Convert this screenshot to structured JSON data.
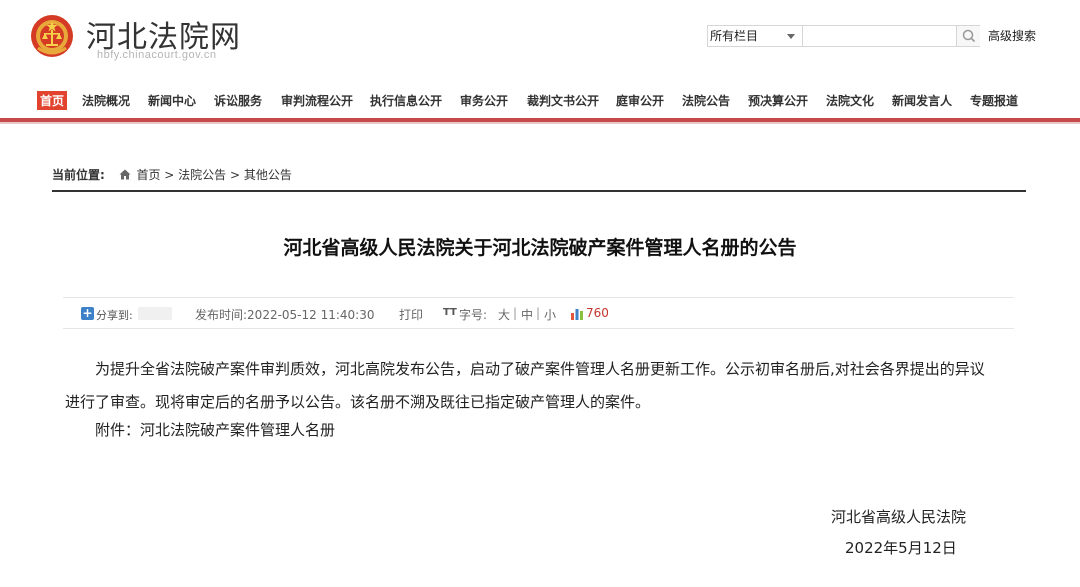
{
  "header": {
    "site_name": "河北法院网",
    "site_domain": "hbfy.chinacourt.gov.cn",
    "search_select": "所有栏目",
    "search_placeholder": "",
    "advanced_search": "高级搜索"
  },
  "nav": {
    "items": [
      {
        "label": "首页",
        "active": true
      },
      {
        "label": "法院概况"
      },
      {
        "label": "新闻中心"
      },
      {
        "label": "诉讼服务"
      },
      {
        "label": "审判流程公开"
      },
      {
        "label": "执行信息公开"
      },
      {
        "label": "审务公开"
      },
      {
        "label": "裁判文书公开"
      },
      {
        "label": "庭审公开"
      },
      {
        "label": "法院公告"
      },
      {
        "label": "预决算公开"
      },
      {
        "label": "法院文化"
      },
      {
        "label": "新闻发言人"
      },
      {
        "label": "专题报道"
      }
    ]
  },
  "breadcrumb": {
    "label": "当前位置:",
    "home": "首页",
    "sep1": " > ",
    "level1": "法院公告",
    "sep2": " > ",
    "level2": "其他公告"
  },
  "article": {
    "title": "河北省高级人民法院关于河北法院破产案件管理人名册的公告",
    "share_label": "分享到:",
    "publish_time": "发布时间:2022-05-12 11:40:30",
    "print": "打印",
    "font_label": "字号:",
    "font_large": "大",
    "font_medium": "中",
    "font_small": "小",
    "font_sep": "|",
    "views": "760",
    "paragraph1_line1": "为提升全省法院破产案件审判质效，河北高院发布公告，启动了破产案件管理人名册更新工作。公示初审名册后,对社会各界提出的异议",
    "paragraph1_line2": "进行了审查。现将审定后的名册予以公告。该名册不溯及既往已指定破产管理人的案件。",
    "attachment": "附件：河北法院破产案件管理人名册",
    "signature": "河北省高级人民法院",
    "date": "2022年5月12日"
  },
  "colors": {
    "accent": "#c8494a",
    "nav_active": "#e1432e",
    "views": "#c5352d"
  }
}
